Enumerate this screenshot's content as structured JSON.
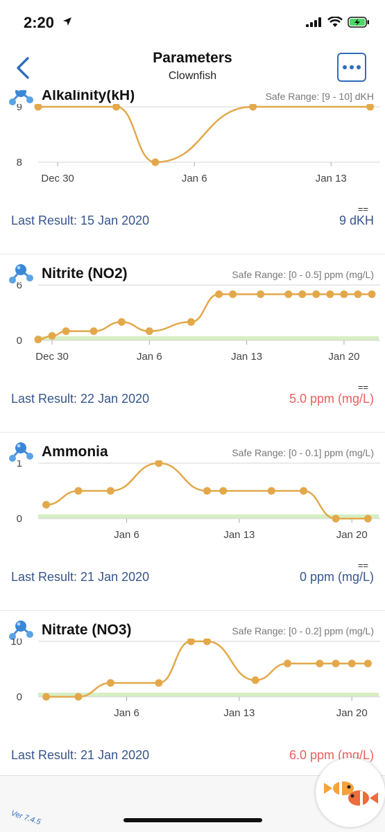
{
  "status": {
    "time": "2:20"
  },
  "nav": {
    "title": "Parameters",
    "subtitle": "Clownfish"
  },
  "colors": {
    "accent": "#2f6dbb",
    "line": "#e3a84a",
    "ok_value": "#37558c",
    "bad_value": "#e8605e",
    "safe_band": "#d6efc3"
  },
  "icons": [
    "back-chevron-icon",
    "more-dots-icon",
    "molecule-icon",
    "fish-icon"
  ],
  "params": [
    {
      "name": "Alkalinity(kH)",
      "safe_range": "Safe Range: [9 - 10] dKH",
      "eq": "==",
      "last_label": "Last Result: 15 Jan 2020",
      "last_value": "9 dKH",
      "out_of_range": false
    },
    {
      "name": "Nitrite (NO2)",
      "safe_range": "Safe Range: [0 - 0.5] ppm (mg/L)",
      "eq": "==",
      "last_label": "Last Result: 22 Jan 2020",
      "last_value": "5.0 ppm (mg/L)",
      "out_of_range": true
    },
    {
      "name": "Ammonia",
      "safe_range": "Safe Range: [0 - 0.1] ppm (mg/L)",
      "eq": "==",
      "last_label": "Last Result: 21 Jan 2020",
      "last_value": "0 ppm (mg/L)",
      "out_of_range": false
    },
    {
      "name": "Nitrate (NO3)",
      "safe_range": "Safe Range: [0 - 0.2] ppm (mg/L)",
      "eq": "",
      "last_label": "Last Result: 21 Jan 2020",
      "last_value": "6.0 ppm (mg/L)",
      "out_of_range": true
    }
  ],
  "chart_data": [
    {
      "type": "line",
      "title": "Alkalinity(kH)",
      "x_ticks": [
        "Dec 30",
        "Jan 6",
        "Jan 13"
      ],
      "y_ticks": [
        "9",
        "8"
      ],
      "ylim": [
        8,
        9
      ],
      "x": [
        "Dec 29",
        "Jan 2",
        "Jan 4",
        "Jan 9",
        "Jan 15"
      ],
      "y": [
        9,
        9,
        8,
        9,
        9
      ],
      "safe_band": [
        9,
        10
      ]
    },
    {
      "type": "line",
      "title": "Nitrite (NO2)",
      "x_ticks": [
        "Dec 30",
        "Jan 6",
        "Jan 13",
        "Jan 20"
      ],
      "y_ticks": [
        "6",
        "0"
      ],
      "ylim": [
        0,
        6
      ],
      "x": [
        "Dec 29",
        "Dec 30",
        "Dec 31",
        "Jan 2",
        "Jan 4",
        "Jan 6",
        "Jan 9",
        "Jan 11",
        "Jan 12",
        "Jan 14",
        "Jan 16",
        "Jan 17",
        "Jan 18",
        "Jan 19",
        "Jan 20",
        "Jan 21",
        "Jan 22"
      ],
      "y": [
        0.1,
        0.5,
        1.0,
        1.0,
        2.0,
        1.0,
        2.0,
        5.0,
        5.0,
        5.0,
        5.0,
        5.0,
        5.0,
        5.0,
        5.0,
        5.0,
        5.0
      ],
      "safe_band": [
        0,
        0.5
      ]
    },
    {
      "type": "line",
      "title": "Ammonia",
      "x_ticks": [
        "Jan 6",
        "Jan 13",
        "Jan 20"
      ],
      "y_ticks": [
        "1",
        "0"
      ],
      "ylim": [
        0,
        1
      ],
      "x": [
        "Jan 1",
        "Jan 3",
        "Jan 5",
        "Jan 8",
        "Jan 11",
        "Jan 12",
        "Jan 15",
        "Jan 17",
        "Jan 19",
        "Jan 21"
      ],
      "y": [
        0.25,
        0.5,
        0.5,
        1.0,
        0.5,
        0.5,
        0.5,
        0.5,
        0.0,
        0.0
      ],
      "safe_band": [
        0,
        0.1
      ]
    },
    {
      "type": "line",
      "title": "Nitrate (NO3)",
      "x_ticks": [
        "Jan 6",
        "Jan 13",
        "Jan 20"
      ],
      "y_ticks": [
        "10",
        "0"
      ],
      "ylim": [
        0,
        10
      ],
      "x": [
        "Jan 1",
        "Jan 3",
        "Jan 5",
        "Jan 8",
        "Jan 10",
        "Jan 11",
        "Jan 14",
        "Jan 16",
        "Jan 18",
        "Jan 19",
        "Jan 20",
        "Jan 21"
      ],
      "y": [
        0,
        0,
        2.5,
        2.5,
        10,
        10,
        3,
        6,
        6,
        6,
        6,
        6
      ],
      "safe_band": [
        0,
        0.2
      ]
    }
  ],
  "footer": {
    "version": "Ver 7.4.5"
  }
}
